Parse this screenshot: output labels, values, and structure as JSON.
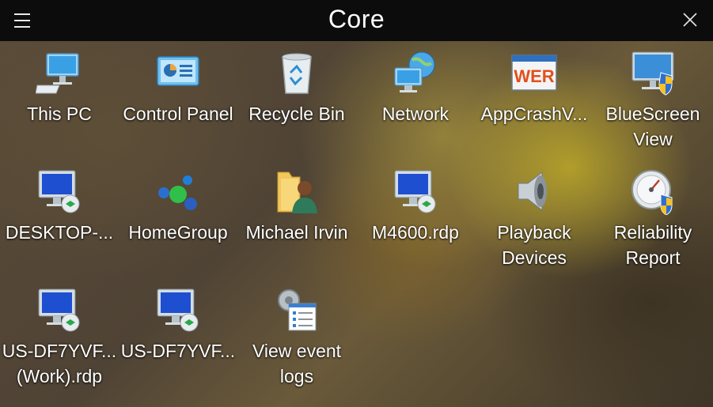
{
  "window": {
    "title": "Core",
    "menu_icon": "hamburger-menu-icon",
    "close_icon": "close-icon"
  },
  "items": [
    {
      "line1": "This PC",
      "line2": "",
      "icon": "computer-icon"
    },
    {
      "line1": "Control Panel",
      "line2": "",
      "icon": "control-panel-icon"
    },
    {
      "line1": "Recycle Bin",
      "line2": "",
      "icon": "recycle-bin-icon"
    },
    {
      "line1": "Network",
      "line2": "",
      "icon": "network-icon"
    },
    {
      "line1": "AppCrashV...",
      "line2": "",
      "icon": "wer-app-icon"
    },
    {
      "line1": "BlueScreen",
      "line2": "View",
      "icon": "monitor-shield-icon"
    },
    {
      "line1": "DESKTOP-...",
      "line2": "",
      "icon": "remote-desktop-icon"
    },
    {
      "line1": "HomeGroup",
      "line2": "",
      "icon": "homegroup-icon"
    },
    {
      "line1": "Michael Irvin",
      "line2": "",
      "icon": "user-folder-icon"
    },
    {
      "line1": "M4600.rdp",
      "line2": "",
      "icon": "remote-desktop-icon"
    },
    {
      "line1": "Playback",
      "line2": "Devices",
      "icon": "speaker-icon"
    },
    {
      "line1": "Reliability",
      "line2": "Report",
      "icon": "gauge-shield-icon"
    },
    {
      "line1": "US-DF7YVF...",
      "line2": "(Work).rdp",
      "icon": "remote-desktop-icon"
    },
    {
      "line1": "US-DF7YVF...",
      "line2": "",
      "icon": "remote-desktop-icon"
    },
    {
      "line1": "View event",
      "line2": "logs",
      "icon": "event-logs-icon"
    }
  ]
}
